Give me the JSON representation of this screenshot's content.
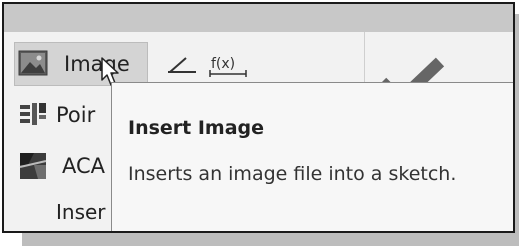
{
  "ribbon": {
    "buttons": [
      {
        "label": "Image",
        "icon": "image-icon"
      },
      {
        "label": "Poir",
        "icon": "points-icon"
      },
      {
        "label": "ACA",
        "icon": "acad-icon"
      }
    ],
    "group_label": "Inser",
    "small_buttons": [
      {
        "icon": "line-dimension-icon"
      },
      {
        "icon": "parameter-fx-icon",
        "text": "f(x)"
      }
    ],
    "confirm_icon": "checkmark-icon"
  },
  "tooltip": {
    "title": "Insert Image",
    "description": "Inserts an image file into a sketch."
  },
  "colors": {
    "checkmark": "#666666",
    "tooltip_bg": "#f7f7f7",
    "hover_bg": "#d4d4d4"
  }
}
